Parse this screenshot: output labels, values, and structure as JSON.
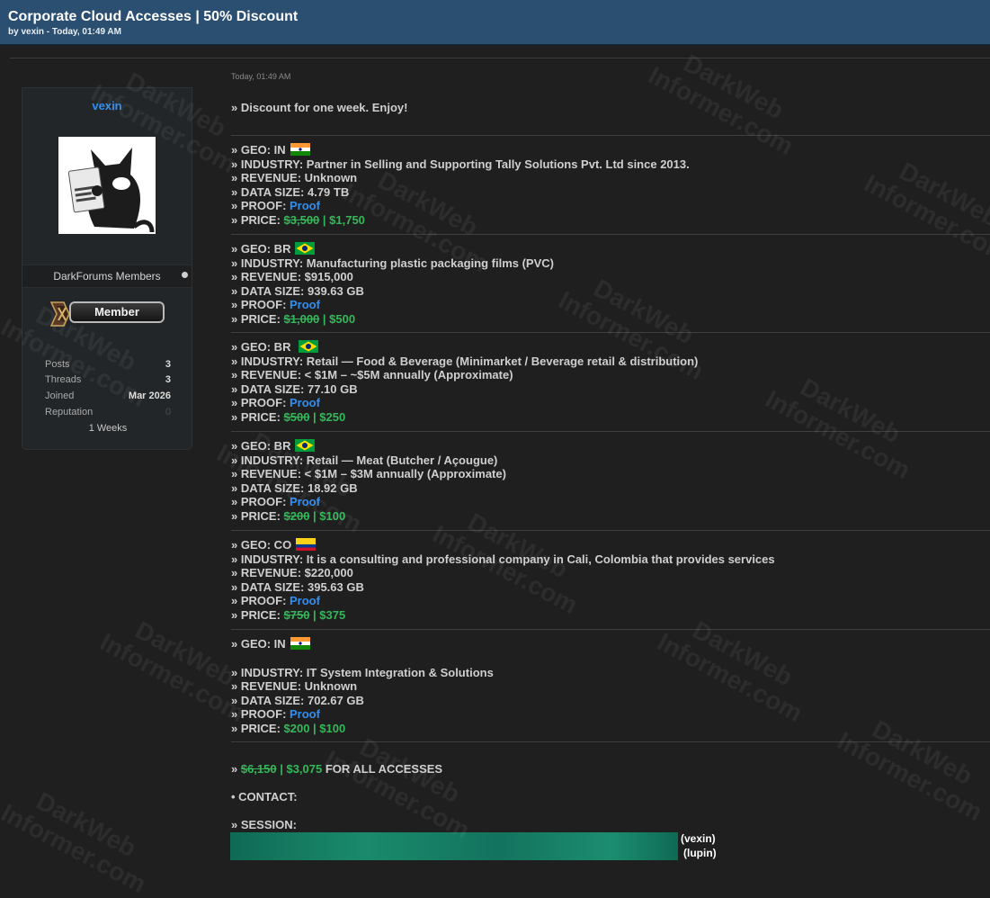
{
  "thread": {
    "title": "Corporate Cloud Accesses | 50% Discount",
    "byline": "by vexin - Today, 01:49 AM"
  },
  "author": {
    "name": "vexin",
    "group": "DarkForums Members",
    "rank_badge": "Member",
    "stats": [
      {
        "label": "Posts",
        "value": "3"
      },
      {
        "label": "Threads",
        "value": "3"
      },
      {
        "label": "Joined",
        "value": "Mar 2026"
      },
      {
        "label": "Reputation",
        "value": "0"
      }
    ],
    "tenure": "1 Weeks"
  },
  "post": {
    "date": "Today, 01:49 AM",
    "intro": "» Discount for one week. Enjoy!",
    "listings": [
      {
        "geo": "» GEO: IN",
        "flag": "india-flag-icon",
        "industry": "» INDUSTRY: Partner in Selling and Supporting Tally Solutions Pvt. Ltd since 2013.",
        "revenue": "» REVENUE: Unknown",
        "data_size": "» DATA SIZE: 4.79 TB",
        "proof_label": "» PROOF: ",
        "proof_link": "Proof",
        "price_label": "» PRICE: ",
        "old_price": "$3,500",
        "new_price": " | $1,750"
      },
      {
        "geo": "» GEO: BR",
        "flag": "brazil-flag-icon",
        "industry": "» INDUSTRY: Manufacturing plastic packaging films (PVC)",
        "revenue": "» REVENUE: $915,000",
        "data_size": "» DATA SIZE: 939.63 GB",
        "proof_label": "» PROOF: ",
        "proof_link": "Proof",
        "price_label": "» PRICE: ",
        "old_price": "$1,000",
        "new_price": " | $500"
      },
      {
        "geo": "» GEO: BR ",
        "flag": "brazil-flag-icon",
        "industry": "» INDUSTRY: Retail — Food & Beverage (Minimarket / Beverage retail & distribution)",
        "revenue": "» REVENUE: < $1M – ~$5M  annually  (Approximate)",
        "data_size": "» DATA SIZE: 77.10 GB",
        "proof_label": "» PROOF: ",
        "proof_link": "Proof",
        "price_label": "» PRICE: ",
        "old_price": "$500",
        "new_price": " | $250"
      },
      {
        "geo": "» GEO: BR",
        "flag": "brazil-flag-icon",
        "industry": "» INDUSTRY: Retail — Meat (Butcher / Açougue)",
        "revenue": "» REVENUE: < $1M – $3M annually (Approximate)",
        "data_size": "» DATA SIZE: 18.92 GB",
        "proof_label": "» PROOF: ",
        "proof_link": "Proof",
        "price_label": "» PRICE: ",
        "old_price": "$200",
        "new_price": " | $100"
      },
      {
        "geo": "» GEO: CO",
        "flag": "colombia-flag-icon",
        "industry": "» INDUSTRY: It is a consulting and professional company in Cali, Colombia that provides services",
        "revenue": "» REVENUE: $220,000",
        "data_size": "» DATA SIZE: 395.63 GB",
        "proof_label": "» PROOF: ",
        "proof_link": "Proof",
        "price_label": "» PRICE: ",
        "old_price": "$750",
        "new_price": " | $375"
      },
      {
        "geo": "» GEO: IN",
        "flag": "india-flag-icon",
        "industry": "» INDUSTRY: IT System Integration & Solutions",
        "revenue": "» REVENUE: Unknown",
        "data_size": "» DATA SIZE: 702.67 GB",
        "proof_label": "» PROOF: ",
        "proof_link": "Proof",
        "price_label": "» PRICE: ",
        "old_price": "",
        "new_price": "$200 | $100"
      }
    ],
    "bundle": {
      "prefix": "» ",
      "old_price": "$6,150",
      "new_price": " | $3,075",
      "suffix": " FOR ALL ACCESSES"
    },
    "contact": "• CONTACT:",
    "session_label": "» SESSION:",
    "session_names": [
      "(vexin)",
      "(lupin)"
    ]
  },
  "watermark": {
    "line1": "DarkWeb",
    "line2": "Informer.com"
  },
  "colors": {
    "header": "#2b4f70",
    "link": "#2f8ff3",
    "price_green": "#35b85a",
    "background": "#1f1f1f"
  }
}
